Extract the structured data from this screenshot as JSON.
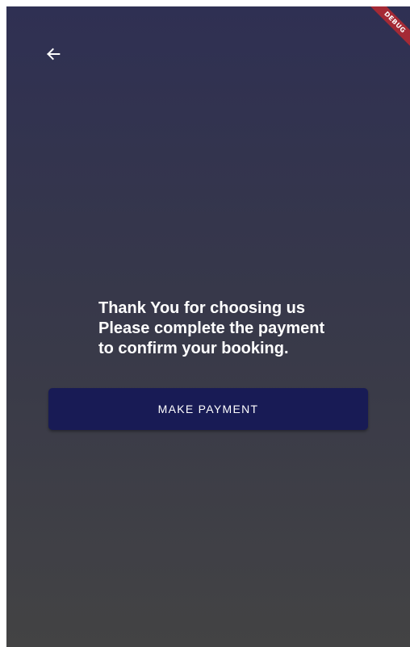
{
  "header": {
    "back_icon": "arrow-left-icon"
  },
  "main": {
    "message_lines": [
      "Thank You for choosing us",
      "Please complete the payment",
      "to confirm your booking."
    ],
    "payment_button_label": "MAKE PAYMENT"
  },
  "debug_banner": {
    "label": "DEBUG"
  },
  "colors": {
    "background_top": "#2f3053",
    "background_bottom": "#434344",
    "button_background": "#181b55",
    "debug_ribbon": "#a52a35",
    "text": "#ffffff"
  }
}
